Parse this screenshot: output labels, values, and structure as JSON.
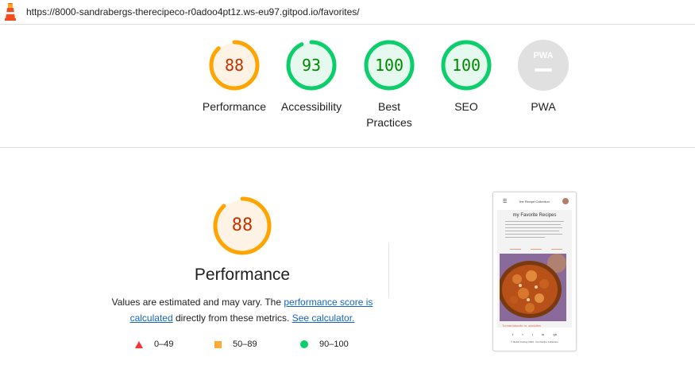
{
  "url": "https://8000-sandrabergs-therecipeco-r0adoo4pt1z.ws-eu97.gitpod.io/favorites/",
  "colors": {
    "orange": "#ffa400",
    "orange_text": "#c33300",
    "orange_bg": "#fff3e6",
    "green": "#0cce6b",
    "green_text": "#008800",
    "green_bg": "#e6f9ef",
    "grey": "#e0e0e0",
    "link": "#1565c0"
  },
  "gauges": [
    {
      "score": "88",
      "label": "Performance",
      "status": "average",
      "fraction": 0.88
    },
    {
      "score": "93",
      "label": "Accessibility",
      "status": "pass",
      "fraction": 0.93
    },
    {
      "score": "100",
      "label": "Best Practices",
      "status": "pass",
      "fraction": 1.0
    },
    {
      "score": "100",
      "label": "SEO",
      "status": "pass",
      "fraction": 1.0
    },
    {
      "score": "",
      "label": "PWA",
      "status": "pwa",
      "fraction": 0,
      "badge_text": "PWA"
    }
  ],
  "performance": {
    "score": "88",
    "fraction": 0.88,
    "title": "Performance",
    "desc_part1": "Values are estimated and may vary. The ",
    "link1": "performance score is calculated",
    "desc_part2": " directly from these metrics. ",
    "link2": "See calculator."
  },
  "legend": [
    {
      "range": "0–49",
      "shape": "triangle"
    },
    {
      "range": "50–89",
      "shape": "square"
    },
    {
      "range": "90–100",
      "shape": "circle"
    }
  ],
  "screenshot": {
    "brand": "the Recipe Collection",
    "title": "my Favorite Recipes",
    "caption": "Tunnbrödsrulle m. skinkfärs",
    "footer": "© Rebel Coding 2023 · the Recipe Collection",
    "icons": [
      "f",
      "t",
      "i",
      "in",
      "gh"
    ]
  }
}
